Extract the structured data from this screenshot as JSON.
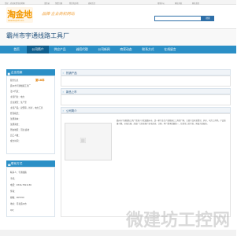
{
  "topbar": {
    "links": [
      "您好，欢迎来到淘金地网",
      "请登录",
      "免费注册",
      "我的淘金地",
      "商家后台",
      "帮助中心",
      "网站导航",
      "网站首页"
    ]
  },
  "header": {
    "logo": "淘金地",
    "logo_url": "www.taojindi.com",
    "slogan": "品牌·企业商机网站",
    "search_button": "搜索"
  },
  "company": {
    "name": "霸州市宇通线路工具厂"
  },
  "nav": {
    "items": [
      "首页",
      "公司简介",
      "供应产品",
      "诚招代理",
      "公司新闻",
      "商家动态",
      "联系方式",
      "在线留言"
    ]
  },
  "sidebar": {
    "company_info": {
      "title": "企业档案",
      "status": "服务信息",
      "years": "第18年",
      "lines": [
        "霸州市宇通线路工具厂",
        "法人代表：",
        "主营行业：电力",
        "企业类型：生产型",
        "主营产品：双臂吊，扒杆，电力工具",
        "经营模式：",
        "注册资本：",
        "注册资金：",
        "所在地区：河北·廊坊",
        "员工人数：",
        "成立时间："
      ]
    },
    "contact": {
      "title": "联系方式",
      "lines": [
        "联系人：宇通线路",
        "手机：",
        "电话：0316-7811136",
        "传真：",
        "邮编：065700",
        "地址：河北霸州市",
        "QQ："
      ]
    }
  },
  "main": {
    "hot_products": "热销产品",
    "new_products": "新品上市",
    "about": "公司简介",
    "intro_text": "霸州市宇通线路工具厂坐落于河北省霸州市，是一家专业生产线路施工工具的厂家，主要产品有双臂吊、扒杆、电力工具等，产品质量可靠，价格合理，欢迎广大新老客户来电咨询、订购。本厂秉承质量第一、信誉至上的宗旨，竭诚为您服务。"
  },
  "watermark": "微建坊工控网"
}
